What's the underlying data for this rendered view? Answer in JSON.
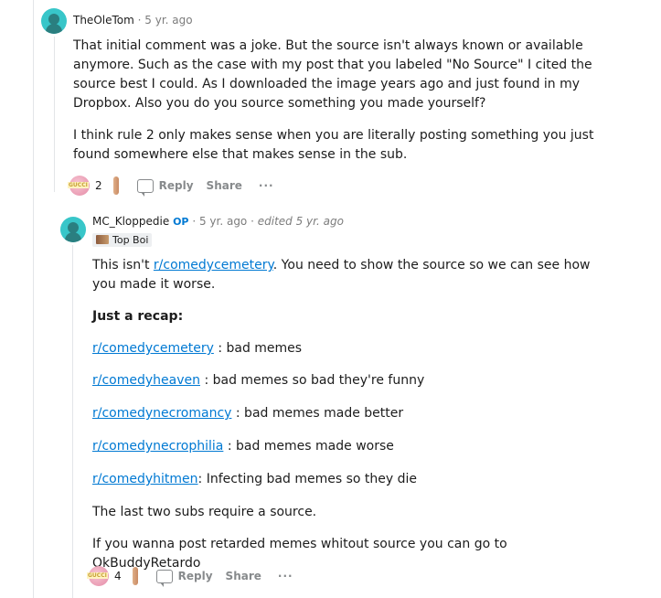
{
  "comments": [
    {
      "author": "TheOleTom",
      "time": "5 yr. ago",
      "paragraphs": [
        "That initial comment was a joke. But the source isn't always known or available anymore. Such as the case with my post that you labeled \"No Source\" I cited the source best I could. As I downloaded the image years ago and just found in my Dropbox. Also you do you source something you made yourself?",
        "I think rule 2 only makes sense when you are literally posting something you just found somewhere else that makes sense in the sub."
      ],
      "award_count": "2",
      "reply_label": "Reply",
      "share_label": "Share",
      "more_label": "···"
    },
    {
      "author": "MC_Kloppedie",
      "op_badge": "OP",
      "time": "5 yr. ago",
      "edited": "edited 5 yr. ago",
      "flair": "Top Boi",
      "intro_prefix": "This isn't ",
      "intro_link": "r/comedycemetery",
      "intro_suffix": ". You need to show the source so we can see how you made it worse.",
      "recap_heading": "Just a recap:",
      "recap": [
        {
          "link": "r/comedycemetery",
          "text": " : bad memes"
        },
        {
          "link": "r/comedyheaven",
          "text": " : bad memes so bad they're funny"
        },
        {
          "link": "r/comedynecromancy",
          "text": " : bad memes made better"
        },
        {
          "link": "r/comedynecrophilia",
          "text": " : bad memes made worse"
        },
        {
          "link": "r/comedyhitmen",
          "text": ": Infecting bad memes so they die"
        }
      ],
      "closing": [
        "The last two subs require a source.",
        "If you wanna post retarded memes whitout source you can go to OkBuddyRetardo"
      ],
      "award_count": "4",
      "reply_label": "Reply",
      "share_label": "Share",
      "more_label": "···"
    }
  ],
  "colors": {
    "link": "#0079d3",
    "avatar": "#38c6c9",
    "meta": "#7c7c7c"
  }
}
